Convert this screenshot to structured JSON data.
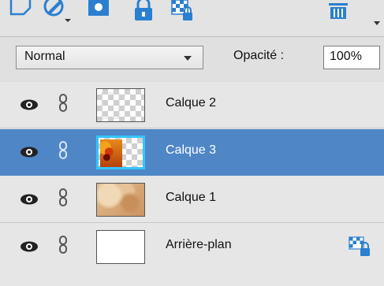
{
  "toolbar": {
    "icons": [
      "new-layer-icon",
      "adjustment-layer-icon",
      "layer-mask-icon",
      "lock-all-icon",
      "lock-transparency-icon",
      "delete-layer-icon",
      "more-options-icon"
    ]
  },
  "blend": {
    "mode": "Normal",
    "opacity_label": "Opacité :",
    "opacity_value": "100%"
  },
  "layers": [
    {
      "name": "Calque 2",
      "thumbnail": "transparent-checker",
      "selected": false,
      "locked": false
    },
    {
      "name": "Calque 3",
      "thumbnail": "orange-fire-texture",
      "selected": true,
      "locked": false
    },
    {
      "name": "Calque 1",
      "thumbnail": "paper-texture",
      "selected": false,
      "locked": false
    },
    {
      "name": "Arrière-plan",
      "thumbnail": "white-fill",
      "selected": false,
      "locked": true
    }
  ],
  "colors": {
    "selection": "#4f86c6",
    "thumbnail_highlight": "#35c5ff",
    "toolbar_blue": "#2a7fd0"
  }
}
